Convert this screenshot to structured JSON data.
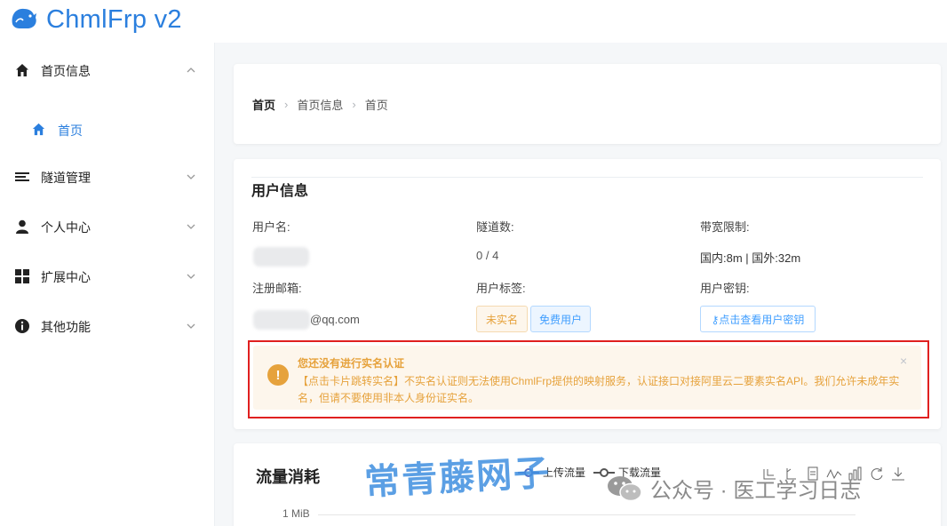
{
  "app": {
    "title": "ChmlFrp v2"
  },
  "sidebar": {
    "items": [
      {
        "label": "首页信息",
        "icon": "home-icon",
        "expanded": true
      },
      {
        "label": "首页",
        "icon": "home-icon",
        "active": true
      },
      {
        "label": "隧道管理",
        "icon": "list-icon"
      },
      {
        "label": "个人中心",
        "icon": "user-icon"
      },
      {
        "label": "扩展中心",
        "icon": "grid-icon"
      },
      {
        "label": "其他功能",
        "icon": "info-icon"
      }
    ]
  },
  "breadcrumb": [
    "首页",
    "首页信息",
    "首页"
  ],
  "user_info": {
    "title": "用户信息",
    "username_label": "用户名:",
    "tunnels_label": "隧道数:",
    "tunnels_value": "0 / 4",
    "bandwidth_label": "带宽限制:",
    "bandwidth_value": "国内:8m | 国外:32m",
    "email_label": "注册邮箱:",
    "email_suffix": "@qq.com",
    "tags_label": "用户标签:",
    "tags": [
      "未实名",
      "免费用户"
    ],
    "secret_label": "用户密钥:",
    "secret_button": "⚷点击查看用户密钥"
  },
  "alert": {
    "title": "您还没有进行实名认证",
    "description": "【点击卡片跳转实名】不实名认证则无法使用ChmlFrp提供的映射服务，认证接口对接阿里云二要素实名API。我们允许未成年实名，但请不要使用非本人身份证实名。"
  },
  "traffic": {
    "title": "流量消耗",
    "legend": [
      "上传流量",
      "下载流量"
    ],
    "y_tick": "1 MiB"
  },
  "watermark": {
    "text": "常青藤网子",
    "wechat": "公众号 · 医工学习日志"
  },
  "colors": {
    "primary": "#2b7fde",
    "warning": "#e6a23c",
    "highlight": "#e02020"
  }
}
